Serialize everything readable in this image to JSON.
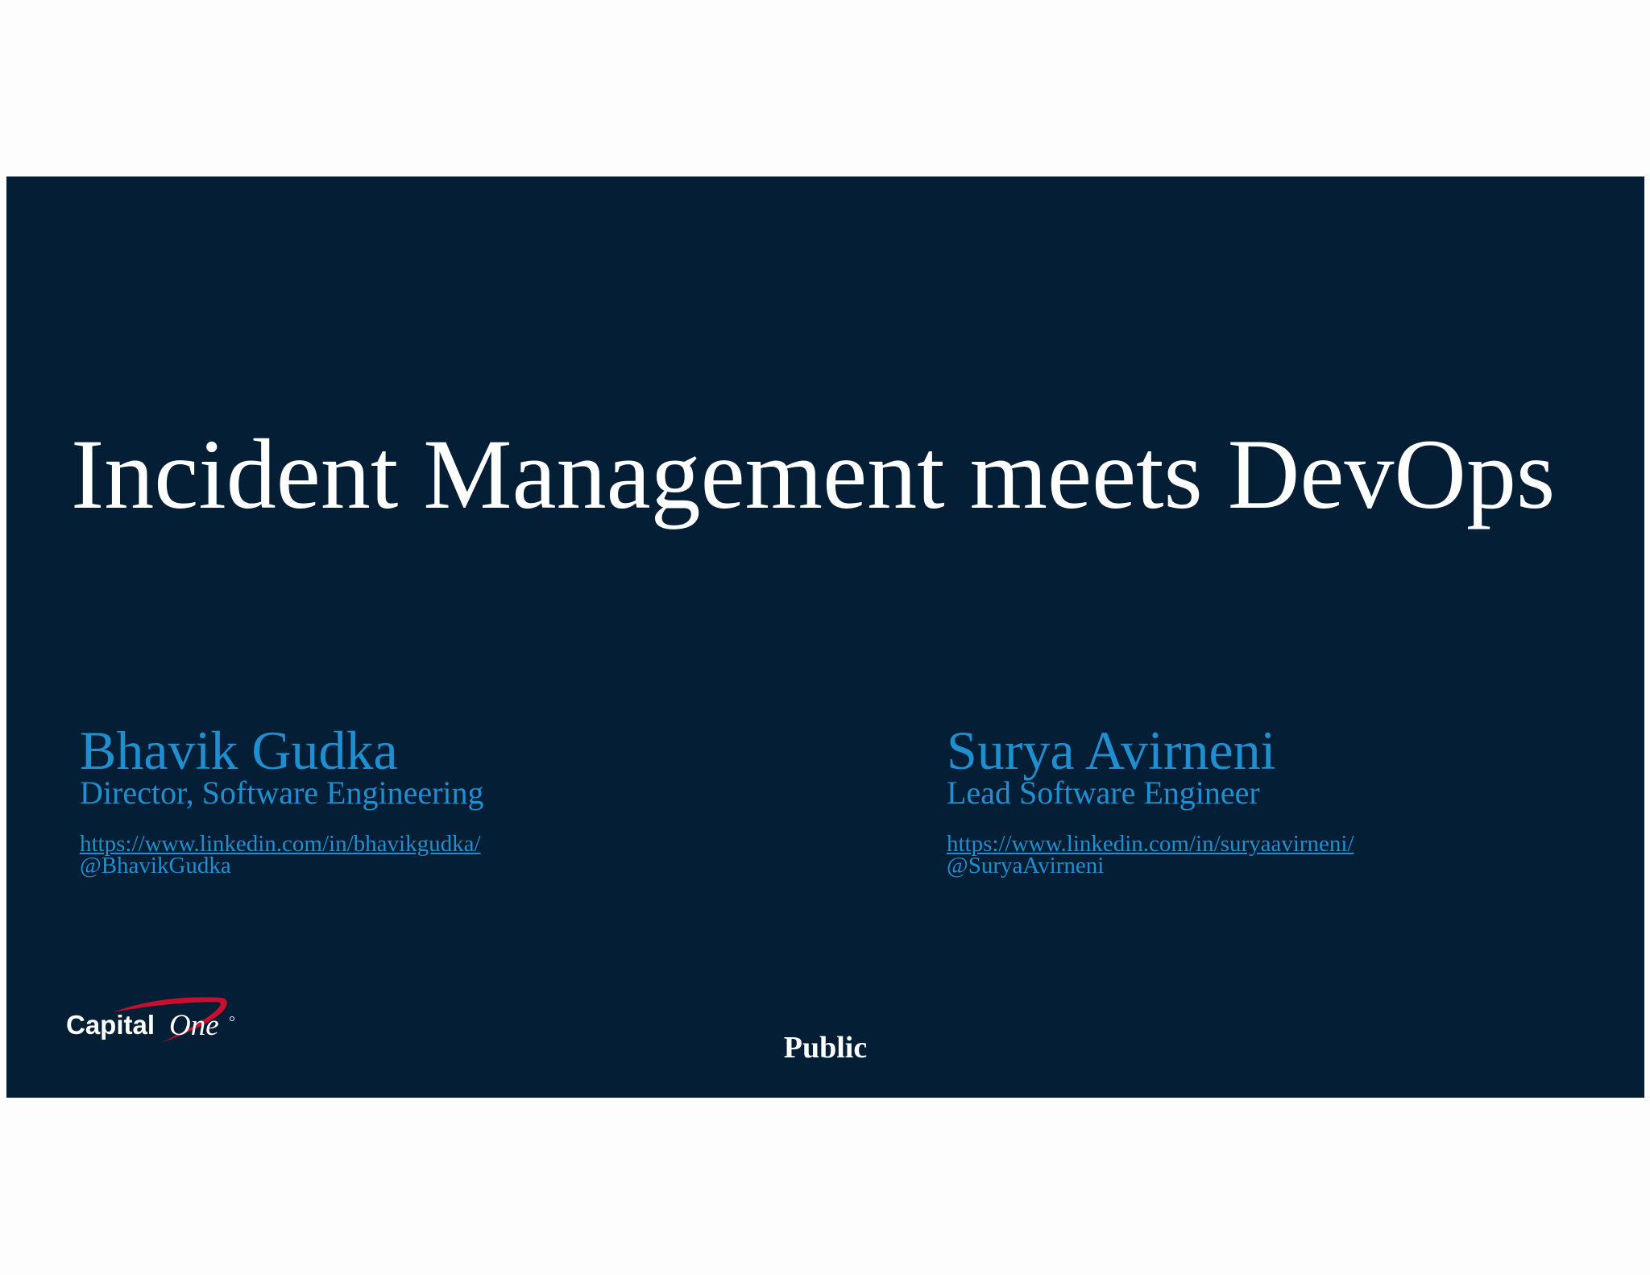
{
  "slide": {
    "title": "Incident Management meets DevOps",
    "classification": "Public",
    "logo_text": "CapitalOne"
  },
  "speakers": [
    {
      "name": "Bhavik Gudka",
      "role": "Director, Software Engineering",
      "linkedin": "https://www.linkedin.com/in/bhavikgudka/",
      "handle": "@BhavikGudka"
    },
    {
      "name": "Surya Avirneni",
      "role": "Lead Software Engineer",
      "linkedin": "https://www.linkedin.com/in/suryaavirneni/",
      "handle": "@SuryaAvirneni"
    }
  ],
  "colors": {
    "slide_background": "#041e36",
    "speaker_text": "#1f8fd0",
    "title_text": "#ffffff",
    "logo_swoosh": "#c8102e"
  }
}
